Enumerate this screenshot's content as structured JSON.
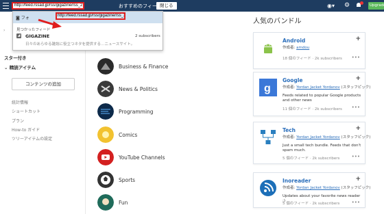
{
  "topbar": {
    "url_value": "http://feed.rssad.jp/rss/gigazine/rss_2.0",
    "recommend_label": "おすすめのフィード",
    "close_label": "閉じる",
    "upgrade_label": "Upgrade"
  },
  "dropdown": {
    "follow_label": "フォ",
    "highlight_url": "http://feed.rssad.jp/rss/gigazine/rss_2.0",
    "found_label": "見つかったフィード",
    "feed_name": "GIGAZINE",
    "feed_subscribers": "2 subscribers",
    "feed_desc": "日々のあらゆる雑誌に役立つネタを提供する…ニュースサイト。"
  },
  "sidebar": {
    "star_label": "スター付き",
    "popular_label": "精読アイテム",
    "add_content_label": "コンテンツの追加",
    "links": [
      "統計情報",
      "ショートカット",
      "プラン",
      "How-to ガイド",
      "ツリーアイテムの設定"
    ]
  },
  "topics": [
    {
      "label": "Business & Finance"
    },
    {
      "label": "News & Politics"
    },
    {
      "label": "Programming"
    },
    {
      "label": "Comics"
    },
    {
      "label": "YouTube Channels"
    },
    {
      "label": "Sports"
    },
    {
      "label": "Fun"
    }
  ],
  "bundles_title": "人気のバンドル",
  "bundles": [
    {
      "title": "Android",
      "author_prefix": "作成者:",
      "author": "amdou",
      "desc": "",
      "meta": "18 個のフィード · 2k subscribers"
    },
    {
      "title": "Google",
      "author_prefix": "作成者:",
      "author": "Yordan Jacket Yordanov",
      "author_suffix": "(スタッフピック)",
      "desc": "Feeds related to popular Google products and other news",
      "meta": "11 個のフィード · 2k subscribers"
    },
    {
      "title": "Tech",
      "author_prefix": "作成者:",
      "author": "Yordan Jacket Yordanov",
      "author_suffix": "(スタッフピック)",
      "desc": "Just a small tech bundle. Feeds that don't spam much.",
      "meta": "5 個のフィード · 2k subscribers"
    },
    {
      "title": "Inoreader",
      "author_prefix": "作成者:",
      "author": "Yordan Jacket Yordanov",
      "author_suffix": "(スタッフピック)",
      "desc": "Updates about your favorite news reader :)",
      "meta": "5 個のフィード · 2k subscribers"
    }
  ],
  "colors": {
    "topbar": "#1e3c60",
    "accent": "#2a6ebb",
    "highlight_border": "#e01e1e",
    "upgrade": "#5cb85c"
  }
}
